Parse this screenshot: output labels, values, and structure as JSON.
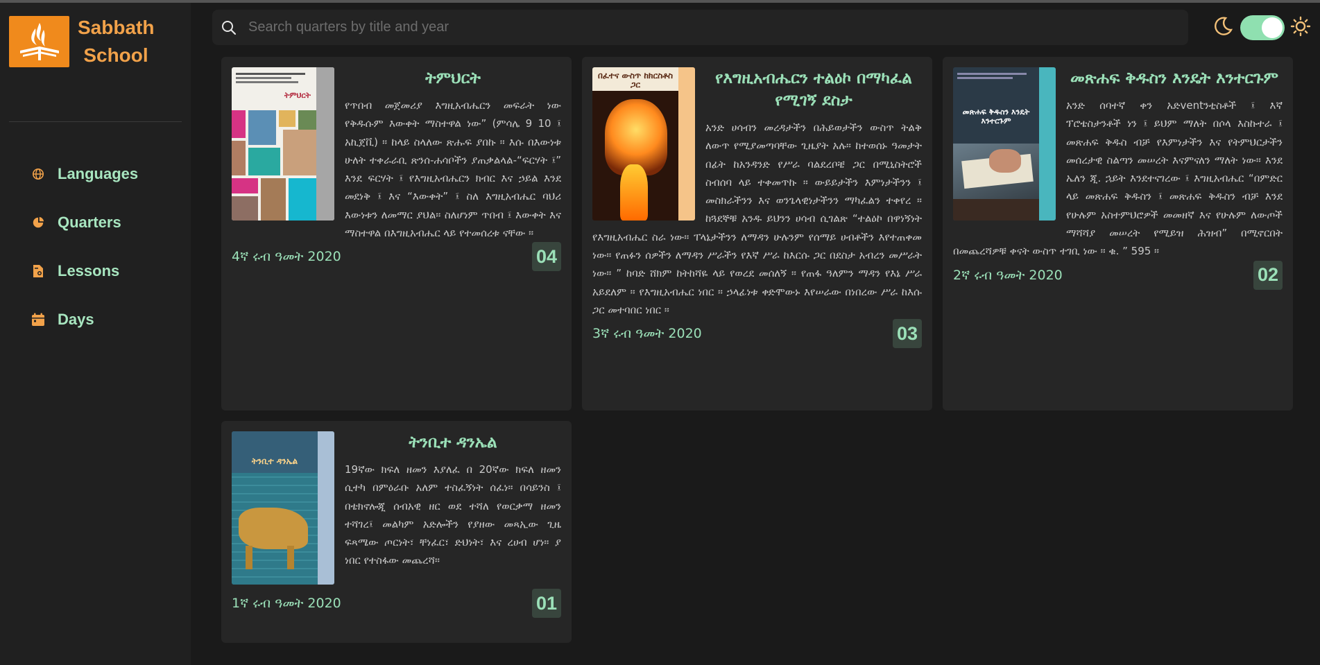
{
  "brand": {
    "line1": "Sabbath",
    "line2": "School",
    "logo_icon": "sda-flame-logo",
    "accent": "#f08a1c"
  },
  "nav": [
    {
      "label": "Languages",
      "icon": "globe-icon"
    },
    {
      "label": "Quarters",
      "icon": "pie-icon"
    },
    {
      "label": "Lessons",
      "icon": "document-icon"
    },
    {
      "label": "Days",
      "icon": "calendar-icon"
    }
  ],
  "search": {
    "placeholder": "Search quarters by title and year",
    "value": ""
  },
  "theme": {
    "mode": "dark",
    "toggle_on": true
  },
  "colors": {
    "title": "#9be0b8",
    "nav_text": "#a8e6c0",
    "badge_bg": "#38453d"
  },
  "quarters": [
    {
      "title": "ትምህርት",
      "description": "የጥበብ መጀመሪያ እግዚአብሔርን መፍራት ነው የቅዱሱም እውቀት ማስተዋል ነው” (ምሳሌ 9 10 ፤ አኪጀቪ) ። ከላይ ስላለው ጽሑፍ ያበኩ ። እሱ በእውነቱ ሁለት ተቀራራቢ ጽንሰ-ሐሳቦችን ያጠቃልላል-“ፍርሃት ፤” እንደ ፍርሃት ፤ የእግዚአብሔርን ክብር እና ኃይል እንደ መደነቅ ፤ እና “እውቀት” ፤ ስለ እግዚአብሔር ባህሪ እውነቱን ለመማር ያህል። ስለሆነም ጥበብ ፤ እውቀት እና ማስተዋል በእግዚአብሔር ላይ የተመሰረቱ ናቸው ።",
      "date": "4ኛ ሩብ ዓመት 2020",
      "number": "04",
      "cover_title": "ትምህርት"
    },
    {
      "title": "የእግዚአብሔርን ተልዕኮ በማካፈል የሚገኝ ደስታ",
      "description": "አንድ ሀሳብን መረዳታችን በሕይወታችን ውስጥ ትልቅ ለውጥ የሚያመጣባቸው ጊዜያት አሉ። ከተወሰኑ ዓመታት በፊት ከአንዳንድ የሥራ ባልደረቦቼ ጋር በሚኒስትሮች ስብሰባ ላይ ተቀመጥኩ ። ውይይታችን እምነታችንን ፤ መስክራችንን እና ወንጌላዊነታችንን ማካፈልን ተቀየረ ። ከጓደኞቹ አንዱ ይህንን ሀሳብ ሲገልጽ “ተልዕኮ በዋነኝነት የእግዚአብሔር ስራ ነው። ፐላኔታችንን ለማዳን ሁሉንም የሰማይ ሀብቶችን እየተጠቀመ ነው። የጠፉን ሰዎችን ለማዳን ሥራችን የእኛ ሥራ ከእርሱ ጋር በደስታ አብረን መሥራት ነው። ” ከባድ ሸክም ከትከሻዬ ላይ የወረደ መሰለኝ ። የጠፋ ዓለምን ማዳን የእኔ ሥራ አይደለም ። የእግዚአብሔር ነበር ። ኃላፊነቱ ቀድሞውኑ እየሠራው በነበረው ሥራ ከእሱ ጋር መተባበር ነበር ።",
      "date": "3ኛ ሩብ ዓመት 2020",
      "number": "03",
      "cover_title": "በፈተና ውስጥ ከክርስቶስ ጋር"
    },
    {
      "title": "መጽሐፍ ቅዱስን እንዴት እንተርጉም",
      "description": "አንድ ሰባተኛ ቀን አድventንቲስቶች ፤ እኛ ፕሮቴስታንቶች ነን ፤ ይህም ማለት በሶላ እስኩተራ ፤ መጽሐፍ ቅዱስ ብቻ የእምነታችን እና የትምህርታችን መሰረታዊ ስልጣን መሠረት እናምናለን ማለት ነው። እንደ ኤለን ጂ. ኋይት እንደተናገረው ፤ እግዚአብሔር “በምድር ላይ መጽሐፍ ቅዱስን ፤ መጽሐፍ ቅዱስን ብቻ እንደ የሁሉም አስተምህሮዎች መመዘኛ እና የሁሉም ለውጦች ማሻሻያ መሠረት የሚይዝ ሕዝብ” በሚኖርበት በመጨረሻዎቹ ቀናት ውስጥ ተገቢ ነው ። ቁ. ” 595 ።",
      "date": "2ኛ ሩብ ዓመት 2020",
      "number": "02",
      "cover_title": "መጽሐፍ ቅዱስን እንዴት እንተርጉም"
    },
    {
      "title": "ትንቢተ ዳንኤል",
      "description": "19ኛው ክፍለ ዘመን እያለፈ በ 20ኛው ክፍለ ዘመን ሲተካ በምዕራቡ አለም ተስፈኝነት ሰፈነ። በሳይንስ ፤ በቴክኖሎጂ ሰብአዊ ዘር ወደ ተሻለ የወርቃማ ዘመን ተሻገረ፤ መልካም አድሎችን የያዘው መጻኢው ጊዜ ፍጻሜው ጦርነት፣ ቸነፈር፣ ድህነት፣ እና ረሀብ ሆነ። ያ ነበር የተስፋው መጨረሻ።",
      "date": "1ኛ ሩብ ዓመት 2020",
      "number": "01",
      "cover_title": "ትንቢተ ዳንኤል"
    }
  ]
}
